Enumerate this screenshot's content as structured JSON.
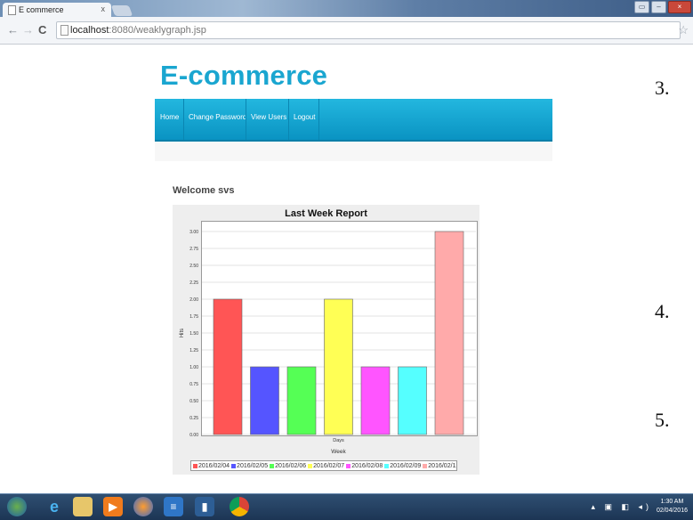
{
  "browser": {
    "tab_title": "E commerce",
    "tab_close": "x",
    "url_host": "localhost",
    "url_rest": ":8080/weaklygraph.jsp",
    "back_icon": "back-arrow-icon",
    "forward_icon": "forward-arrow-icon",
    "reload_icon": "reload-icon",
    "bookmark_icon": "star-icon"
  },
  "page": {
    "brand": "E-commerce",
    "menu": [
      "Home",
      "Change Password",
      "View Users",
      "Logout"
    ],
    "welcome": "Welcome svs",
    "accent_color": "#1aa6d0"
  },
  "side_numbers": [
    "3.",
    "4.",
    "5."
  ],
  "chart_data": {
    "type": "bar",
    "title": "Last Week Report",
    "xlabel": "Days",
    "xlabel2": "Week",
    "ylabel": "Hits",
    "ylim": [
      0,
      3.0
    ],
    "yticks": [
      "0.00",
      "0.25",
      "0.50",
      "0.75",
      "1.00",
      "1.25",
      "1.50",
      "1.75",
      "2.00",
      "2.25",
      "2.50",
      "2.75",
      "3.00"
    ],
    "grid": true,
    "legend_position": "bottom",
    "series": [
      {
        "name": "2016/02/04",
        "value": 2,
        "color": "#ff5555"
      },
      {
        "name": "2016/02/05",
        "value": 1,
        "color": "#5555ff"
      },
      {
        "name": "2016/02/06",
        "value": 1,
        "color": "#55ff55"
      },
      {
        "name": "2016/02/07",
        "value": 2,
        "color": "#ffff55"
      },
      {
        "name": "2016/02/08",
        "value": 1,
        "color": "#ff55ff"
      },
      {
        "name": "2016/02/09",
        "value": 1,
        "color": "#55ffff"
      },
      {
        "name": "2016/02/12",
        "value": 3,
        "color": "#ffaaaa"
      }
    ]
  },
  "taskbar": {
    "time": "1:30 AM",
    "date": "02/04/2016"
  }
}
